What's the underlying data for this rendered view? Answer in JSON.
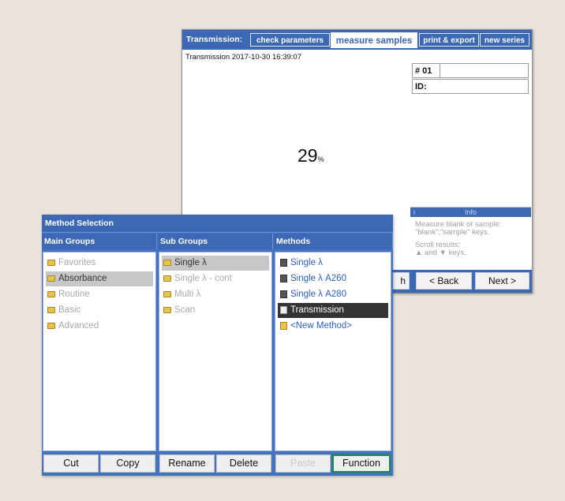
{
  "transmission": {
    "title": "Transmission:",
    "tabs": [
      "check parameters",
      "measure samples",
      "print & export",
      "new series"
    ],
    "active_tab": "measure samples",
    "subtitle": "Transmission 2017-10-30 16:39:07",
    "sample_no": "# 01",
    "id_label": "ID:",
    "result_value": "29",
    "result_unit": "%",
    "info": {
      "icon": "i",
      "header": "Info",
      "line1": "Measure blank or sample:",
      "line2": "\"blank\";\"sample\" keys.",
      "line3": "Scroll results:",
      "line4": "▲ and ▼ keys."
    },
    "buttons": {
      "partial": "h",
      "back": "< Back",
      "next": "Next >"
    }
  },
  "method_selection": {
    "title": "Method Selection",
    "columns": {
      "main": "Main Groups",
      "sub": "Sub Groups",
      "methods": "Methods"
    },
    "main_groups": [
      "Favorites",
      "Absorbance",
      "Routine",
      "Basic",
      "Advanced"
    ],
    "main_selected": "Absorbance",
    "sub_groups": [
      "Single λ",
      "Single λ - cont",
      "Multi λ",
      "Scan"
    ],
    "sub_selected": "Single λ",
    "methods": [
      "Single λ",
      "Single λ A260",
      "Single λ A280",
      "Transmission",
      "<New Method>"
    ],
    "method_selected": "Transmission",
    "buttons": {
      "cut": "Cut",
      "copy": "Copy",
      "rename": "Rename",
      "delete": "Delete",
      "paste": "Paste",
      "function": "Function"
    }
  },
  "colors": {
    "bar_blue": "#3c68b5",
    "function_border": "#1e8a4a",
    "folder_yellow": "#e8c34a"
  }
}
